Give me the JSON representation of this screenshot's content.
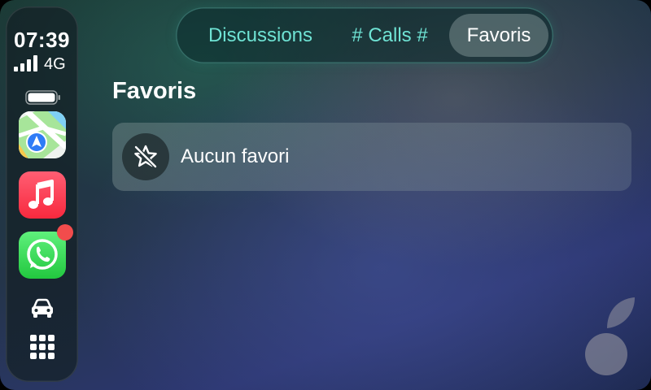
{
  "status": {
    "time": "07:39",
    "network": "4G",
    "signal_bars": 4,
    "battery_level": 1.0
  },
  "dock": {
    "apps": [
      {
        "name": "maps",
        "icon": "maps-app-icon"
      },
      {
        "name": "music",
        "icon": "music-app-icon"
      },
      {
        "name": "whatsapp",
        "icon": "whatsapp-app-icon",
        "badge": true
      }
    ],
    "car_icon": "car-icon",
    "grid_icon": "app-grid-icon"
  },
  "tabs": [
    {
      "label": "Discussions",
      "selected": false
    },
    {
      "label": "# Calls #",
      "selected": false
    },
    {
      "label": "Favoris",
      "selected": true
    }
  ],
  "page": {
    "title": "Favoris",
    "empty_row": {
      "label": "Aucun favori",
      "icon": "star-slash-icon"
    }
  },
  "colors": {
    "tab_text": "#6fe3d4",
    "badge": "#f24c4c",
    "music_red": "#f8293e",
    "whatsapp_green": "#22c83f"
  }
}
